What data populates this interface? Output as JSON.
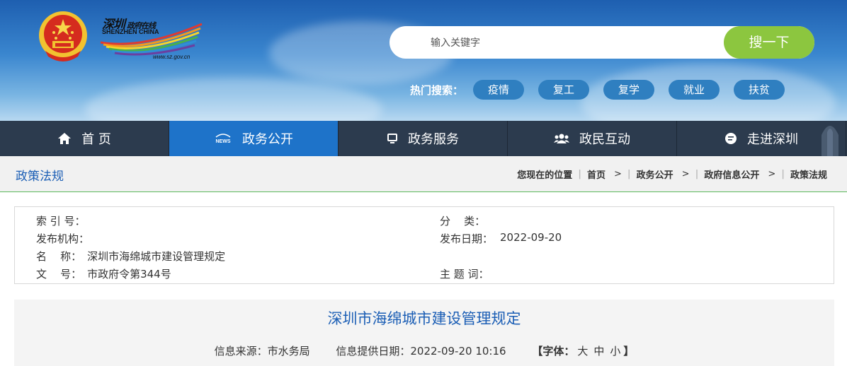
{
  "brand": {
    "name_cn": "深圳",
    "tagline_cn": "政府在线",
    "name_en": "SHENZHEN CHINA",
    "url": "www.sz.gov.cn"
  },
  "search": {
    "placeholder": "输入关键字",
    "button_label": "搜一下"
  },
  "hot_search": {
    "label": "热门搜索：",
    "tags": [
      "疫情",
      "复工",
      "复学",
      "就业",
      "扶贫"
    ]
  },
  "nav": {
    "items": [
      {
        "label": "首 页",
        "icon": "home-icon"
      },
      {
        "label": "政务公开",
        "icon": "news-icon",
        "icon_text": "NEWS"
      },
      {
        "label": "政务服务",
        "icon": "monitor-icon"
      },
      {
        "label": "政民互动",
        "icon": "people-icon"
      },
      {
        "label": "走进深圳",
        "icon": "chat-icon"
      }
    ],
    "active_index": 1
  },
  "page": {
    "section_title": "政策法规",
    "breadcrumb": {
      "prefix": "您现在的位置",
      "items": [
        "首页",
        "政务公开",
        "政府信息公开",
        "政策法规"
      ],
      "separator": ">"
    }
  },
  "info": {
    "index_label": "索 引 号：",
    "index_value": "",
    "category_label": "分    类：",
    "category_value": "",
    "publisher_label": "发布机构：",
    "publisher_value": "",
    "date_label": "发布日期：",
    "date_value": "2022-09-20",
    "name_label": "名    称：",
    "name_value": "深圳市海绵城市建设管理规定",
    "doc_label": "文    号：",
    "doc_value": "市政府令第344号",
    "topic_label": "主 题 词：",
    "topic_value": ""
  },
  "article": {
    "title": "深圳市海绵城市建设管理规定",
    "source": "信息来源：市水务局",
    "provided_date": "信息提供日期：2022-09-20 10:16",
    "font_size_open": "【字体：",
    "font_large": "大",
    "font_medium": "中",
    "font_small": "小",
    "font_size_close": "】"
  },
  "colors": {
    "accent_blue": "#1e73c9",
    "nav_bg": "#2c3b4e",
    "search_button": "#8cc63f",
    "link_blue": "#1b5eb5"
  }
}
